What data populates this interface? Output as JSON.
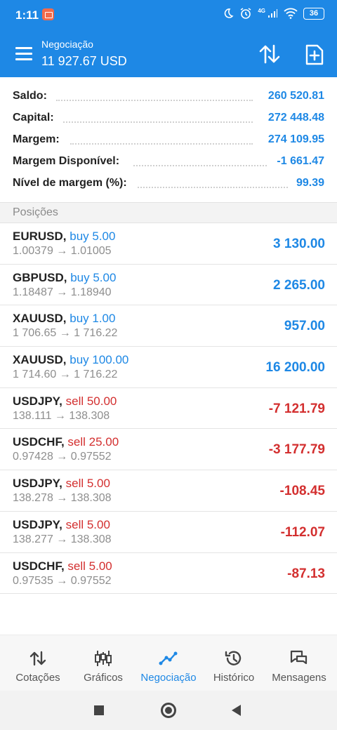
{
  "status_bar": {
    "time": "1:11",
    "battery": "36",
    "net_label": "4G"
  },
  "app_bar": {
    "title": "Negociação",
    "balance": "11 927.67 USD",
    "color": "#1e88e5"
  },
  "summary": [
    {
      "label": "Saldo:",
      "value": "260 520.81"
    },
    {
      "label": "Capital:",
      "value": "272 448.48"
    },
    {
      "label": "Margem:",
      "value": "274 109.95"
    },
    {
      "label": "Margem Disponível:",
      "value": "-1 661.47"
    },
    {
      "label": "Nível de margem (%):",
      "value": "99.39"
    }
  ],
  "positions_header": "Posições",
  "positions": [
    {
      "symbol": "EURUSD,",
      "side": "buy 5.00",
      "type": "buy",
      "prices": "1.00379 → 1.01005",
      "pl": "3 130.00",
      "pl_sign": "positive"
    },
    {
      "symbol": "GBPUSD,",
      "side": "buy 5.00",
      "type": "buy",
      "prices": "1.18487 → 1.18940",
      "pl": "2 265.00",
      "pl_sign": "positive"
    },
    {
      "symbol": "XAUUSD,",
      "side": "buy 1.00",
      "type": "buy",
      "prices": "1 706.65 → 1 716.22",
      "pl": "957.00",
      "pl_sign": "positive"
    },
    {
      "symbol": "XAUUSD,",
      "side": "buy 100.00",
      "type": "buy",
      "prices": "1 714.60 → 1 716.22",
      "pl": "16 200.00",
      "pl_sign": "positive"
    },
    {
      "symbol": "USDJPY,",
      "side": "sell 50.00",
      "type": "sell",
      "prices": "138.111 → 138.308",
      "pl": "-7 121.79",
      "pl_sign": "negative"
    },
    {
      "symbol": "USDCHF,",
      "side": "sell 25.00",
      "type": "sell",
      "prices": "0.97428 → 0.97552",
      "pl": "-3 177.79",
      "pl_sign": "negative"
    },
    {
      "symbol": "USDJPY,",
      "side": "sell 5.00",
      "type": "sell",
      "prices": "138.278 → 138.308",
      "pl": "-108.45",
      "pl_sign": "negative"
    },
    {
      "symbol": "USDJPY,",
      "side": "sell 5.00",
      "type": "sell",
      "prices": "138.277 → 138.308",
      "pl": "-112.07",
      "pl_sign": "negative"
    },
    {
      "symbol": "USDCHF,",
      "side": "sell 5.00",
      "type": "sell",
      "prices": "0.97535 → 0.97552",
      "pl": "-87.13",
      "pl_sign": "negative"
    }
  ],
  "bottom_nav": [
    {
      "label": "Cotações",
      "icon": "quotes-arrows-icon",
      "active": false
    },
    {
      "label": "Gráficos",
      "icon": "candlestick-chart-icon",
      "active": false
    },
    {
      "label": "Negociação",
      "icon": "trade-line-icon",
      "active": true
    },
    {
      "label": "Histórico",
      "icon": "history-clock-icon",
      "active": false
    },
    {
      "label": "Mensagens",
      "icon": "messages-icon",
      "active": false
    }
  ],
  "colors": {
    "accent": "#1e88e5",
    "profit": "#1e88e5",
    "loss": "#d32f2f"
  }
}
